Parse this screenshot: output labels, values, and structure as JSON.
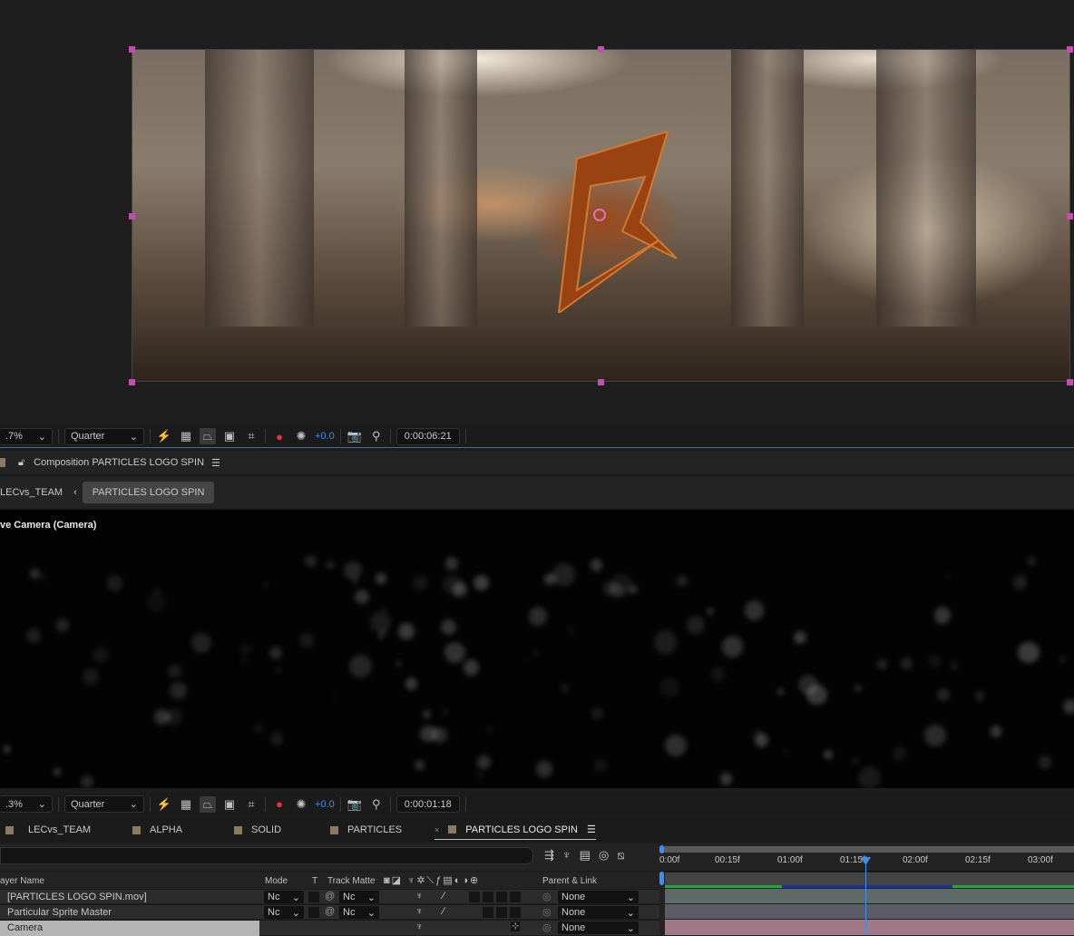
{
  "viewer_top": {
    "zoom": ".7%",
    "resolution": "Quarter",
    "exposure": "+0.0",
    "timecode": "0:00:06:21"
  },
  "comp_panel": {
    "title": "Composition PARTICLES LOGO SPIN",
    "breadcrumbs": [
      "LECvs_TEAM",
      "PARTICLES LOGO SPIN"
    ]
  },
  "viewer_bottom": {
    "view_label": "ve Camera (Camera)",
    "zoom": ".3%",
    "resolution": "Quarter",
    "exposure": "+0.0",
    "timecode": "0:00:01:18"
  },
  "timeline_tabs": [
    {
      "label": "LECvs_TEAM"
    },
    {
      "label": "ALPHA"
    },
    {
      "label": "SOLID"
    },
    {
      "label": "PARTICLES"
    },
    {
      "label": "PARTICLES LOGO SPIN",
      "active": true
    }
  ],
  "columns": {
    "layer_name": "ayer Name",
    "mode": "Mode",
    "t": "T",
    "track_matte": "Track Matte",
    "parent": "Parent & Link"
  },
  "layers": [
    {
      "name": "[PARTICLES LOGO SPIN.mov]",
      "mode": "Nc",
      "matte": "Nc",
      "parent": "None"
    },
    {
      "name": "Particular Sprite Master",
      "mode": "Nc",
      "matte": "Nc",
      "parent": "None"
    },
    {
      "name": "Camera",
      "parent": "None",
      "selected": true
    }
  ],
  "ruler": [
    "0:00f",
    "00:15f",
    "01:00f",
    "01:15f",
    "02:00f",
    "02:15f",
    "03:00f"
  ],
  "colors": {
    "accent": "#3d8ef2",
    "handle": "#c050b0",
    "work_area_green": "#22a83a",
    "work_area_blue": "#1a2fa0",
    "camera_bar": "#a07888"
  }
}
